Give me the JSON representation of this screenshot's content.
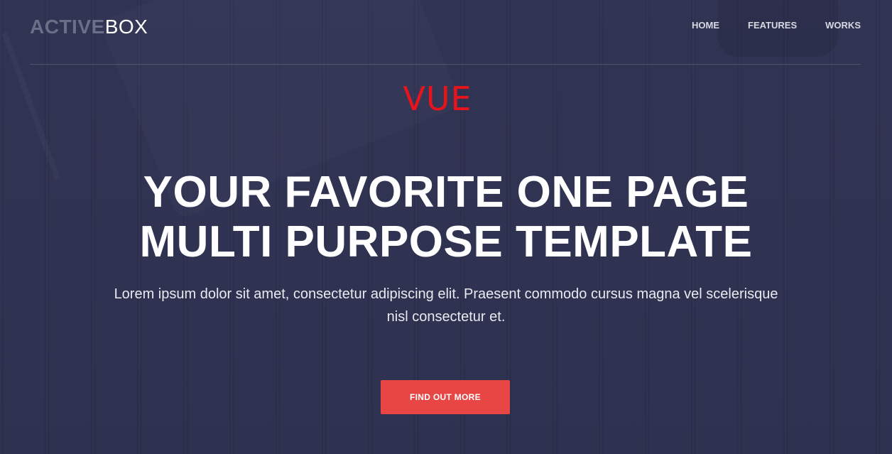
{
  "brand": {
    "bold": "ACTIVE",
    "light": "BOX"
  },
  "nav": {
    "items": [
      {
        "label": "HOME"
      },
      {
        "label": "FEATURES"
      },
      {
        "label": "WORKS"
      }
    ]
  },
  "overlay_label": "VUE",
  "hero": {
    "title_line1": "YOUR FAVORITE ONE PAGE",
    "title_line2": "MULTI PURPOSE TEMPLATE",
    "text": "Lorem ipsum dolor sit amet, consectetur adipiscing elit. Praesent commodo cursus magna vel scelerisque nisl consectetur et.",
    "cta_label": "FIND OUT MORE"
  },
  "colors": {
    "background": "#2e3150",
    "accent": "#e84545",
    "overlay_label": "#e8141b",
    "logo_bold": "#6a6e86"
  }
}
